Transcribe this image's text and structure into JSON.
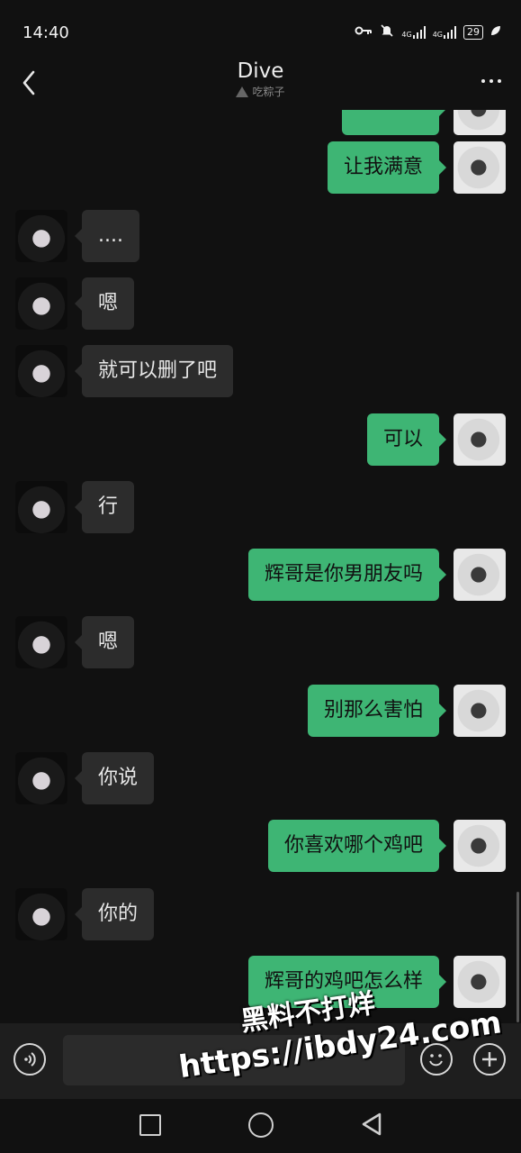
{
  "status_bar": {
    "time": "14:40",
    "network_1": "4G",
    "network_2": "4G",
    "battery": "29"
  },
  "header": {
    "title": "Dive",
    "subtitle": "吃粽子"
  },
  "messages": [
    {
      "side": "right",
      "text": "",
      "partial": true
    },
    {
      "side": "right",
      "text": "让我满意"
    },
    {
      "side": "left",
      "text": "...."
    },
    {
      "side": "left",
      "text": "嗯"
    },
    {
      "side": "left",
      "text": "就可以删了吧"
    },
    {
      "side": "right",
      "text": "可以"
    },
    {
      "side": "left",
      "text": "行"
    },
    {
      "side": "right",
      "text": "辉哥是你男朋友吗"
    },
    {
      "side": "left",
      "text": "嗯"
    },
    {
      "side": "right",
      "text": "别那么害怕"
    },
    {
      "side": "left",
      "text": "你说"
    },
    {
      "side": "right",
      "text": "你喜欢哪个鸡吧"
    },
    {
      "side": "left",
      "text": "你的"
    },
    {
      "side": "right",
      "text": "辉哥的鸡吧怎么样"
    }
  ],
  "input": {
    "value": "",
    "placeholder": ""
  },
  "watermark": {
    "line1": "黑料不打烊",
    "line2": "https://ibdy24.com"
  },
  "colors": {
    "background": "#111111",
    "bubble_sent": "#3eb574",
    "bubble_received": "#2c2c2c"
  },
  "icons": {
    "back": "chevron-left-icon",
    "more": "more-dots-icon",
    "voice": "voice-icon",
    "emoji": "emoji-icon",
    "plus": "plus-icon"
  }
}
